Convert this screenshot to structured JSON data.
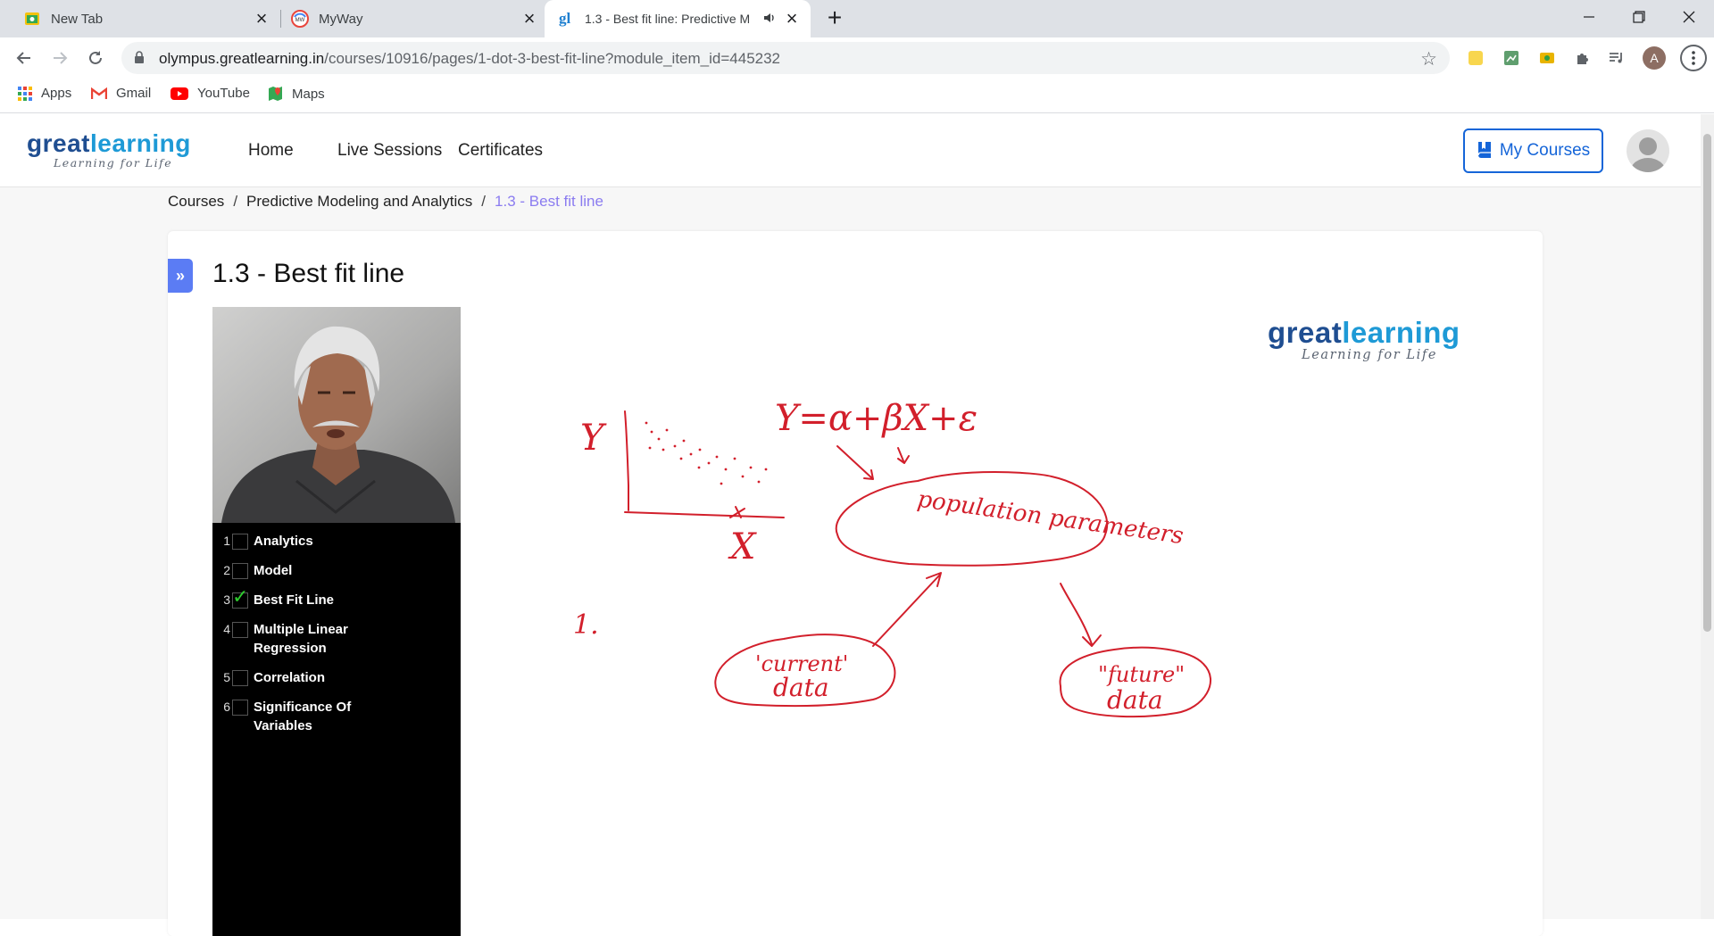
{
  "browser": {
    "tabs": [
      {
        "title": "New Tab"
      },
      {
        "title": "MyWay"
      },
      {
        "title": "1.3 - Best fit line: Predictive M"
      }
    ],
    "url_main": "olympus.greatlearning.in",
    "url_path": "/courses/10916/pages/1-dot-3-best-fit-line?module_item_id=445232",
    "profile_initial": "A",
    "bookmarks": [
      {
        "label": "Apps"
      },
      {
        "label": "Gmail"
      },
      {
        "label": "YouTube"
      },
      {
        "label": "Maps"
      }
    ]
  },
  "site": {
    "logo_brand_a": "great",
    "logo_brand_b": "learning",
    "logo_tagline": "Learning for Life",
    "nav": [
      "Home",
      "Live Sessions",
      "Certificates"
    ],
    "my_courses": "My Courses"
  },
  "breadcrumb": {
    "items": [
      "Courses",
      "Predictive Modeling and Analytics"
    ],
    "current": "1.3 - Best fit line",
    "separator": "/"
  },
  "page": {
    "expand_icon": "»",
    "title": "1.3 - Best fit line"
  },
  "video": {
    "logo_brand_a": "great",
    "logo_brand_b": "learning",
    "logo_tagline": "Learning for Life",
    "toc": [
      {
        "num": "1",
        "label": "Analytics",
        "checked": false
      },
      {
        "num": "2",
        "label": "Model",
        "checked": false
      },
      {
        "num": "3",
        "label": "Best Fit Line",
        "checked": true
      },
      {
        "num": "4",
        "label": "Multiple Linear Regression",
        "checked": false
      },
      {
        "num": "5",
        "label": "Correlation",
        "checked": false
      },
      {
        "num": "6",
        "label": "Significance Of Variables",
        "checked": false
      }
    ],
    "board": {
      "equation": "Y=α+βX+ε",
      "axis_y": "Y",
      "axis_x": "X",
      "center_cloud": "population parameters",
      "left_cloud_1": "'current'",
      "left_cloud_2": "data",
      "right_cloud_1": "\"future\"",
      "right_cloud_2": "data",
      "margin_num": "1."
    }
  },
  "colors": {
    "accent_blue": "#1565d8",
    "breadcrumb_current": "#8b7cf0",
    "expand_button": "#5b7cf4",
    "ink_red": "#d21f2b",
    "logo_dark": "#1f4e91",
    "logo_light": "#1e9ad6"
  }
}
